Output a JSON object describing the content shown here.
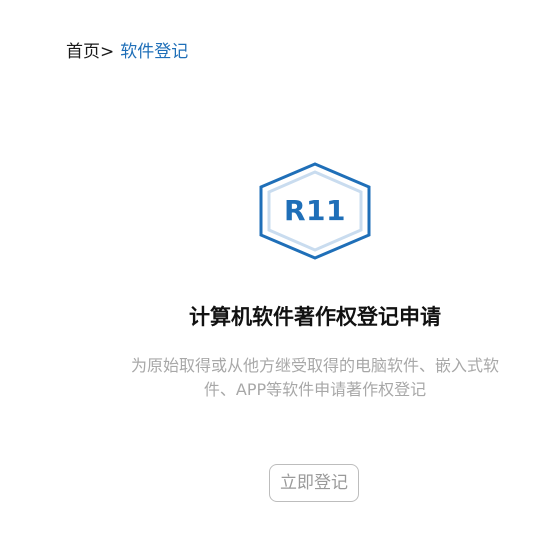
{
  "breadcrumb": {
    "home": "首页",
    "separator": ">",
    "current": "软件登记"
  },
  "service": {
    "code": "R11",
    "icon": "hexagon-badge-icon",
    "title": "计算机软件著作权登记申请",
    "description": "为原始取得或从他方继受取得的电脑软件、嵌入式软件、APP等软件申请著作权登记",
    "button_label": "立即登记"
  },
  "colors": {
    "accent": "#1f6fb8",
    "accent_light": "#c9dcef",
    "muted_text": "#a8a8a8",
    "button_border": "#bdbdbd"
  }
}
